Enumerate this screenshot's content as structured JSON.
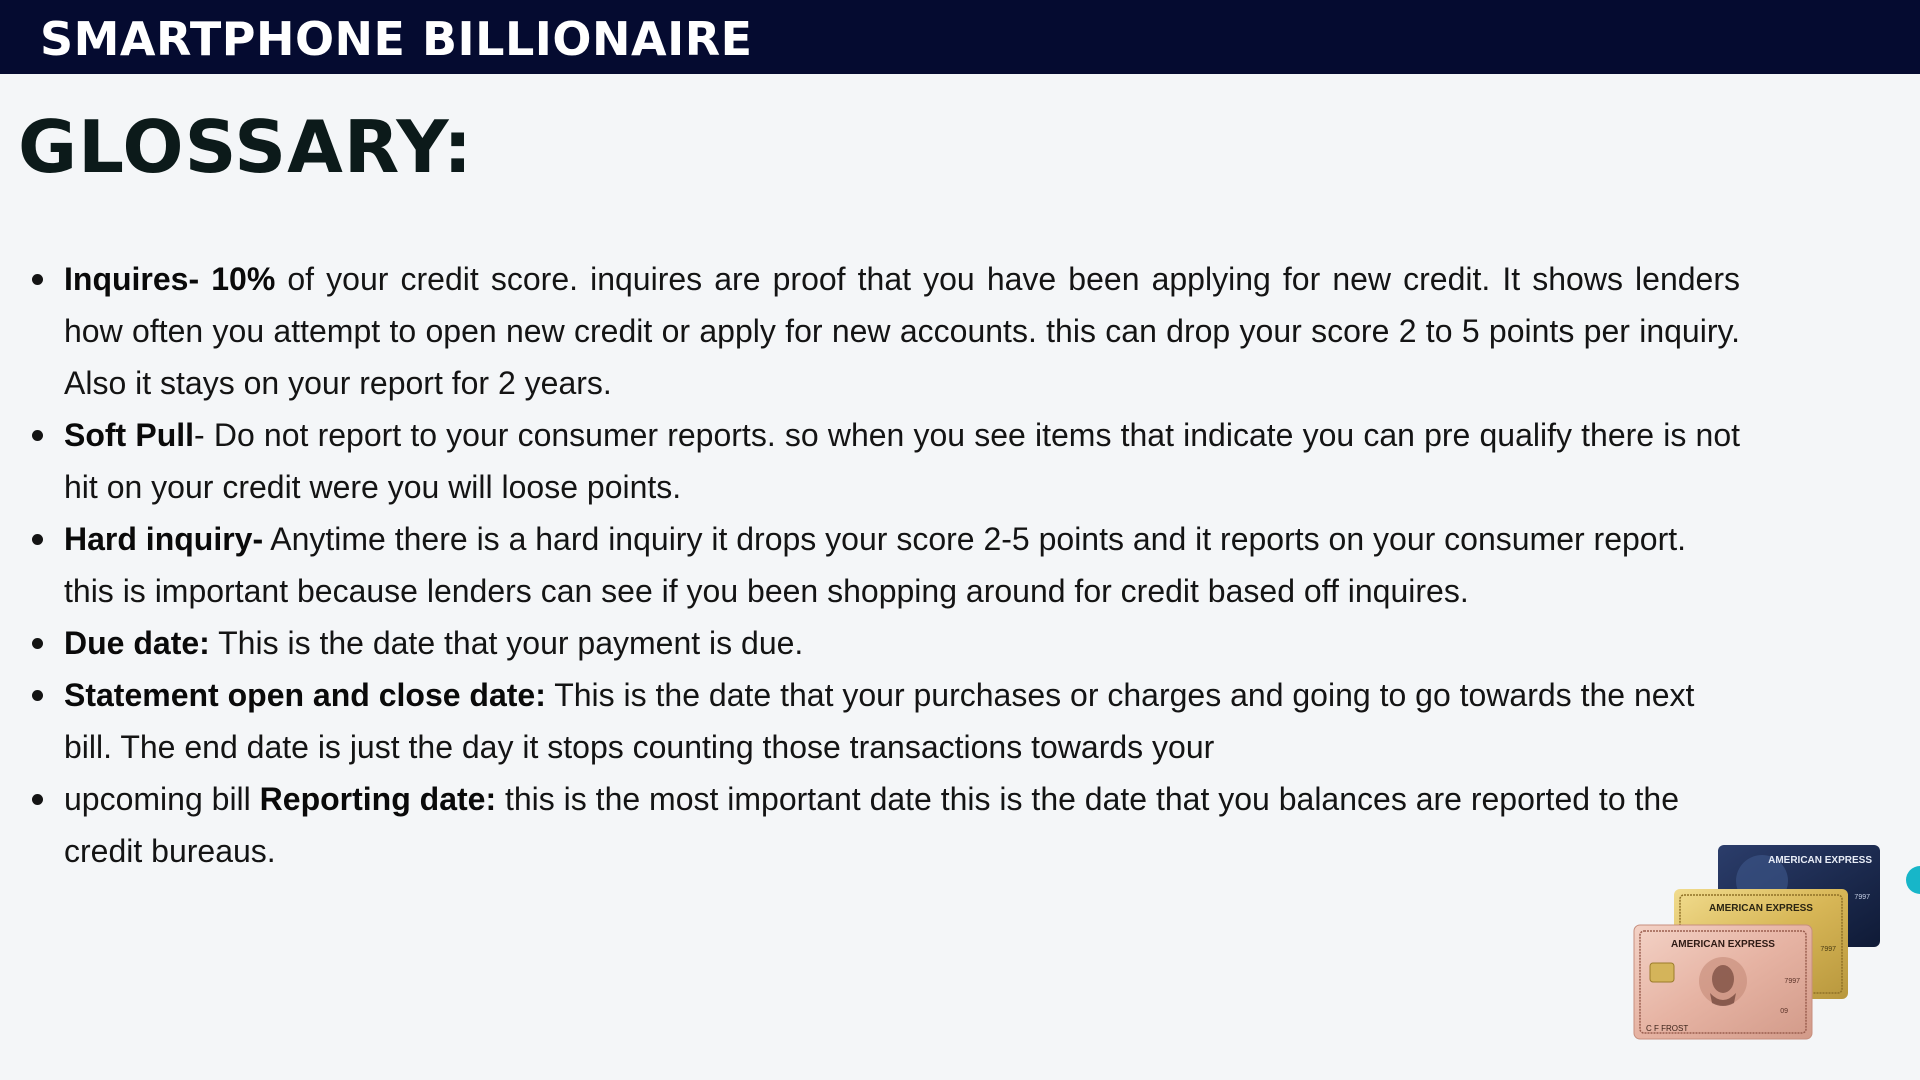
{
  "header": {
    "brand": "SMARTPHONE BILLIONAIRE",
    "background_color": "#050b30"
  },
  "page_title": "GLOSSARY:",
  "glossary": [
    {
      "term": "Inquires- 10%",
      "definition": " of your credit score. inquires are proof that you have been applying for new credit. It shows lenders how often you attempt to open new credit or apply for new accounts. this can drop your score 2 to 5 points per inquiry. Also it stays on your report for 2 years."
    },
    {
      "term": "Soft Pull",
      "definition": "- Do not report to your consumer reports. so when you see items that indicate you can pre qualify there is not hit on your credit were you will loose points."
    },
    {
      "term": "Hard inquiry-",
      "definition": " Anytime there is a hard inquiry it drops your score 2-5 points and it reports on your consumer report. this is important because lenders can see if you been shopping around for credit based off inquires."
    },
    {
      "term": "Due date:",
      "definition": " This is the date that your payment is due."
    },
    {
      "term": "Statement open and close date:",
      "definition": " This is the date that your purchases or charges and going to go towards the next bill. The end date is just the day it stops counting those transactions towards your"
    },
    {
      "lead": "upcoming bill ",
      "term": "Reporting date:",
      "definition": " this is the most important date this is the date that you balances are reported to the credit bureaus."
    }
  ],
  "cards_image": {
    "back_card": {
      "brand": "AMERICAN EXPRESS",
      "number": "7997"
    },
    "middle_card": {
      "brand": "AMERICAN EXPRESS",
      "number": "7997"
    },
    "front_card": {
      "brand": "AMERICAN EXPRESS",
      "number": "7997",
      "holder": "C F FROST",
      "expiry": "09"
    }
  },
  "colors": {
    "page_background": "#f4f6f8",
    "text": "#141414",
    "accent_teal": "#17b6c9"
  }
}
